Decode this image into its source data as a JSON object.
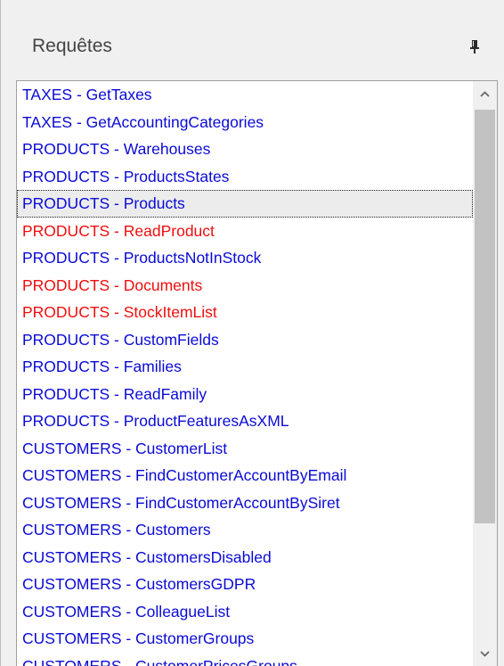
{
  "panel": {
    "title": "Requêtes"
  },
  "list": {
    "items": [
      {
        "label": "TAXES - GetTaxes",
        "color": "#0a0ad6"
      },
      {
        "label": "TAXES - GetAccountingCategories",
        "color": "#0a0ad6"
      },
      {
        "label": "PRODUCTS - Warehouses",
        "color": "#0a0ad6"
      },
      {
        "label": "PRODUCTS - ProductsStates",
        "color": "#0a0ad6"
      },
      {
        "label": "PRODUCTS - Products",
        "color": "#0a0ad6",
        "selected": true
      },
      {
        "label": "PRODUCTS - ReadProduct",
        "color": "#f00e0e"
      },
      {
        "label": "PRODUCTS - ProductsNotInStock",
        "color": "#0a0ad6"
      },
      {
        "label": "PRODUCTS - Documents",
        "color": "#f00e0e"
      },
      {
        "label": "PRODUCTS - StockItemList",
        "color": "#f00e0e"
      },
      {
        "label": "PRODUCTS - CustomFields",
        "color": "#0a0ad6"
      },
      {
        "label": "PRODUCTS - Families",
        "color": "#0a0ad6"
      },
      {
        "label": "PRODUCTS - ReadFamily",
        "color": "#0a0ad6"
      },
      {
        "label": "PRODUCTS - ProductFeaturesAsXML",
        "color": "#0a0ad6"
      },
      {
        "label": "CUSTOMERS - CustomerList",
        "color": "#0a0ad6"
      },
      {
        "label": "CUSTOMERS - FindCustomerAccountByEmail",
        "color": "#0a0ad6"
      },
      {
        "label": "CUSTOMERS - FindCustomerAccountBySiret",
        "color": "#0a0ad6"
      },
      {
        "label": "CUSTOMERS - Customers",
        "color": "#0a0ad6"
      },
      {
        "label": "CUSTOMERS - CustomersDisabled",
        "color": "#0a0ad6"
      },
      {
        "label": "CUSTOMERS - CustomersGDPR",
        "color": "#0a0ad6"
      },
      {
        "label": "CUSTOMERS - ColleagueList",
        "color": "#0a0ad6"
      },
      {
        "label": "CUSTOMERS - CustomerGroups",
        "color": "#0a0ad6"
      },
      {
        "label": "CUSTOMERS - CustomerPricesGroups",
        "color": "#0a0ad6"
      }
    ]
  },
  "icons": {
    "pin": "pin-icon",
    "scroll_up": "chevron-up-icon",
    "scroll_down": "chevron-down-icon"
  },
  "colors": {
    "item_default": "#0a0ad6",
    "item_error": "#f00e0e",
    "panel_bg": "#f0f0f0",
    "scroll_thumb": "#c2c2c2"
  },
  "scroll": {
    "visible_fraction": 0.7
  }
}
